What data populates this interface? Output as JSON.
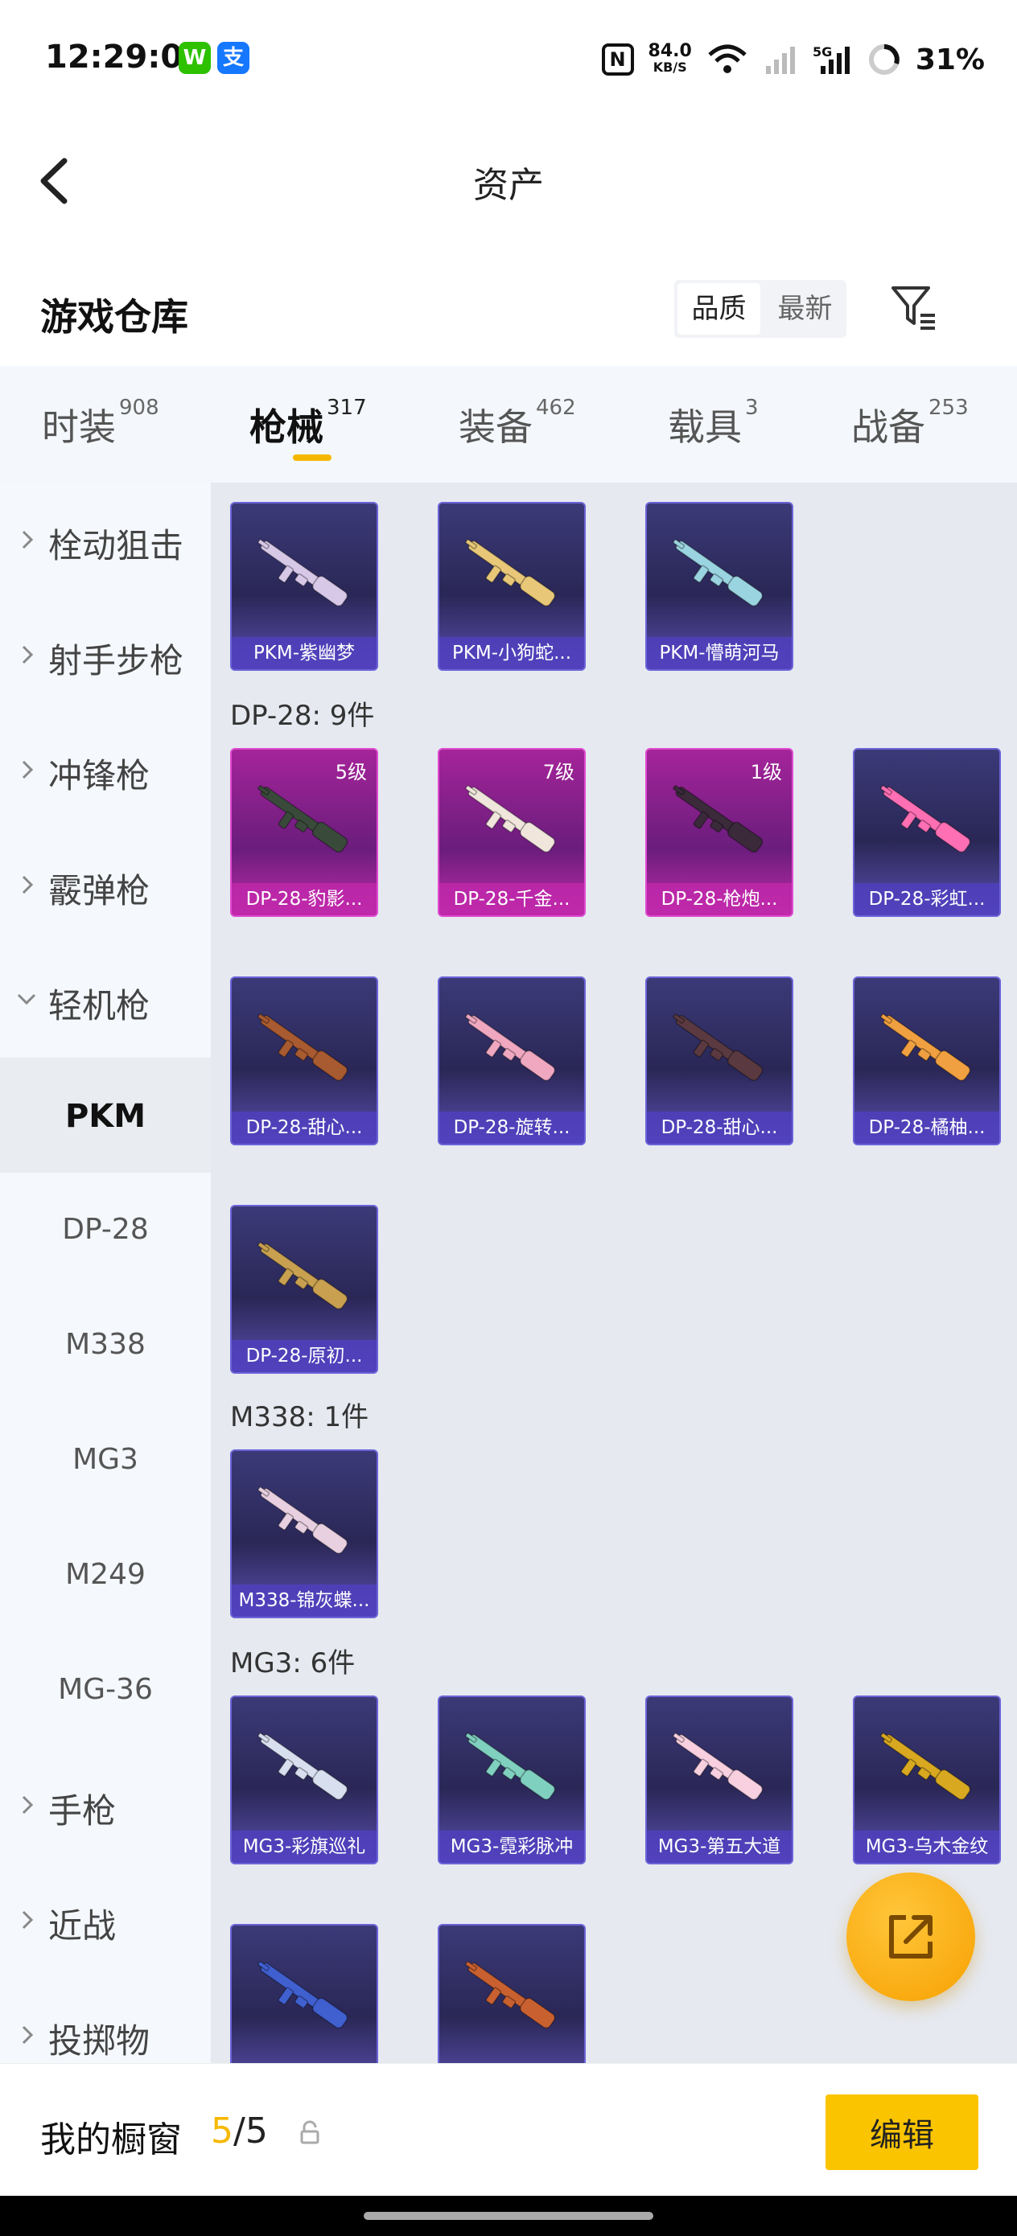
{
  "status": {
    "time": "12:29:09",
    "app1": "W",
    "app2": "支",
    "nfc": "N",
    "speed_value": "84.0",
    "speed_unit": "KB/S",
    "battery": "31%"
  },
  "header": {
    "title": "资产"
  },
  "warehouse": {
    "title": "游戏仓库",
    "sort_quality": "品质",
    "sort_newest": "最新"
  },
  "tabs": [
    {
      "label": "时装",
      "count": "908"
    },
    {
      "label": "枪械",
      "count": "317"
    },
    {
      "label": "装备",
      "count": "462"
    },
    {
      "label": "载具",
      "count": "3"
    },
    {
      "label": "战备",
      "count": "253"
    }
  ],
  "sidebar": {
    "items": [
      {
        "label": "栓动狙击"
      },
      {
        "label": "射手步枪"
      },
      {
        "label": "冲锋枪"
      },
      {
        "label": "霰弹枪"
      },
      {
        "label": "轻机枪"
      },
      {
        "label": "PKM"
      },
      {
        "label": "DP-28"
      },
      {
        "label": "M338"
      },
      {
        "label": "MG3"
      },
      {
        "label": "M249"
      },
      {
        "label": "MG-36"
      },
      {
        "label": "手枪"
      },
      {
        "label": "近战"
      },
      {
        "label": "投掷物"
      }
    ]
  },
  "content": {
    "pkm_items": [
      {
        "name": "PKM-紫幽梦",
        "color": "#d8c8e8"
      },
      {
        "name": "PKM-小狗蛇...",
        "color": "#e8c878"
      },
      {
        "name": "PKM-懵萌河马",
        "color": "#9ad4e0"
      }
    ],
    "dp28_header": "DP-28: 9件",
    "dp28_items": [
      {
        "name": "DP-28-豹影...",
        "level": "5级",
        "color": "#3a4a3a"
      },
      {
        "name": "DP-28-千金...",
        "level": "7级",
        "color": "#f0e6dc"
      },
      {
        "name": "DP-28-枪炮...",
        "level": "1级",
        "color": "#3a2a3a"
      },
      {
        "name": "DP-28-彩虹...",
        "level": "",
        "color": "#ff6fb4"
      },
      {
        "name": "DP-28-甜心...",
        "level": "",
        "color": "#a85a30"
      },
      {
        "name": "DP-28-旋转...",
        "level": "",
        "color": "#f0a8c0"
      },
      {
        "name": "DP-28-甜心...",
        "level": "",
        "color": "#5a3a40"
      },
      {
        "name": "DP-28-橘柚...",
        "level": "",
        "color": "#f0a040"
      },
      {
        "name": "DP-28-原初...",
        "level": "",
        "color": "#c8a050"
      }
    ],
    "m338_header": "M338: 1件",
    "m338_items": [
      {
        "name": "M338-锦灰蝶...",
        "color": "#e8d0e0"
      }
    ],
    "mg3_header": "MG3: 6件",
    "mg3_items": [
      {
        "name": "MG3-彩旗巡礼",
        "color": "#d8e0f0"
      },
      {
        "name": "MG3-霓彩脉冲",
        "color": "#80d0c0"
      },
      {
        "name": "MG3-第五大道",
        "color": "#f8d0e0"
      },
      {
        "name": "MG3-乌木金纹",
        "color": "#d8a820"
      },
      {
        "name": "",
        "color": "#4060d0"
      },
      {
        "name": "",
        "color": "#c86030"
      }
    ]
  },
  "bottom": {
    "label": "我的橱窗",
    "count_current": "5",
    "count_sep": "/",
    "count_total": "5",
    "edit_label": "编辑"
  },
  "colors": {
    "accent": "#f5b800",
    "fab": "#f7a000"
  }
}
